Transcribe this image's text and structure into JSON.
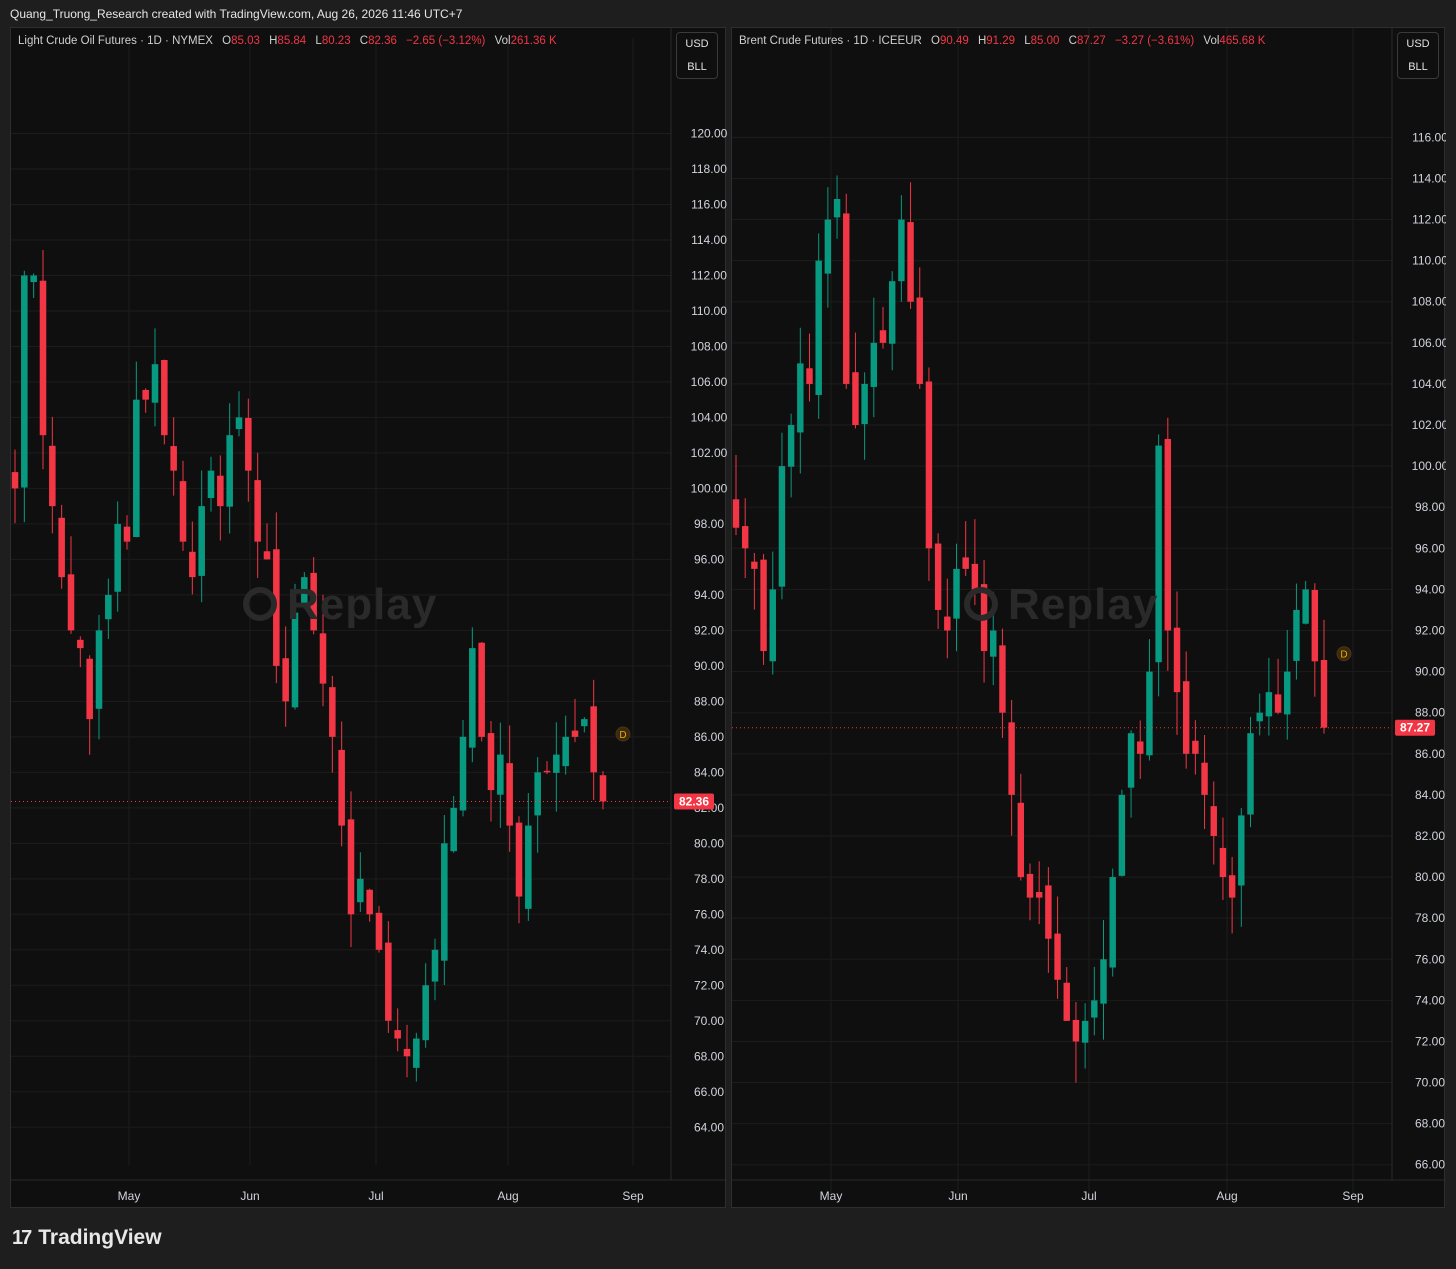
{
  "header": {
    "attribution": "Quang_Truong_Research created with TradingView.com, Aug 26, 2026 11:46 UTC+7"
  },
  "footer": {
    "brand": "TradingView",
    "logo_icon": "tradingview-logo-icon"
  },
  "colors": {
    "up": "#089981",
    "down": "#f23645",
    "background": "#0f0f0f",
    "grid": "#1c1c1c",
    "axis_text": "#d1d4dc"
  },
  "panels": [
    {
      "symbol": "Light Crude Oil Futures",
      "interval": "1D",
      "exchange": "NYMEX",
      "open_label": "O",
      "open": "85.03",
      "high_label": "H",
      "high": "85.84",
      "low_label": "L",
      "low": "80.23",
      "close_label": "C",
      "close": "82.36",
      "change": "−2.65 (−3.12%)",
      "vol_label": "Vol",
      "volume": "261.36 K",
      "currency": "USD",
      "unit": "BLL",
      "watermark": "Replay",
      "marker": "D",
      "last_price_label": "82.36"
    },
    {
      "symbol": "Brent Crude Futures",
      "interval": "1D",
      "exchange": "ICEEUR",
      "open_label": "O",
      "open": "90.49",
      "high_label": "H",
      "high": "91.29",
      "low_label": "L",
      "low": "85.00",
      "close_label": "C",
      "close": "87.27",
      "change": "−3.27 (−3.61%)",
      "vol_label": "Vol",
      "volume": "465.68 K",
      "currency": "USD",
      "unit": "BLL",
      "watermark": "Replay",
      "marker": "D",
      "last_price_label": "87.27"
    }
  ],
  "chart_data": [
    {
      "type": "candlestick",
      "title": "Light Crude Oil Futures · 1D · NYMEX",
      "x": [
        "May",
        "Jun",
        "Jul",
        "Aug",
        "Sep"
      ],
      "y_ticks": [
        "64.00",
        "66.00",
        "68.00",
        "70.00",
        "72.00",
        "74.00",
        "76.00",
        "78.00",
        "80.00",
        "82.00",
        "84.00",
        "86.00",
        "88.00",
        "90.00",
        "92.00",
        "94.00",
        "96.00",
        "98.00",
        "100.00",
        "102.00",
        "104.00",
        "106.00",
        "108.00",
        "110.00",
        "112.00",
        "114.00",
        "116.00",
        "118.00",
        "120.00"
      ],
      "ylim": [
        63,
        122
      ],
      "last_price": 82.36,
      "series": [
        {
          "name": "Light Crude Oil Futures",
          "closes": [
            100,
            112,
            112,
            103,
            99,
            95,
            92,
            91,
            87,
            92,
            94,
            98,
            97,
            105,
            105,
            107,
            103,
            101,
            97,
            95,
            99,
            101,
            99,
            103,
            104,
            101,
            97,
            96,
            90,
            88,
            93,
            95,
            92,
            89,
            86,
            81,
            76,
            78,
            76,
            74,
            70,
            69,
            68,
            69,
            72,
            74,
            80,
            82,
            86,
            91,
            86,
            83,
            85,
            81,
            77,
            81,
            84,
            84,
            85,
            86,
            86,
            87,
            84,
            82.36
          ]
        }
      ]
    },
    {
      "type": "candlestick",
      "title": "Brent Crude Futures · 1D · ICEEUR",
      "x": [
        "May",
        "Jun",
        "Jul",
        "Aug",
        "Sep"
      ],
      "y_ticks": [
        "66.00",
        "68.00",
        "70.00",
        "72.00",
        "74.00",
        "76.00",
        "78.00",
        "80.00",
        "82.00",
        "84.00",
        "86.00",
        "88.00",
        "90.00",
        "92.00",
        "94.00",
        "96.00",
        "98.00",
        "100.00",
        "102.00",
        "104.00",
        "106.00",
        "108.00",
        "110.00",
        "112.00",
        "114.00",
        "116.00"
      ],
      "ylim": [
        65.5,
        118.5
      ],
      "last_price": 87.27,
      "series": [
        {
          "name": "Brent Crude Futures",
          "closes": [
            97,
            96,
            95,
            91,
            94,
            100,
            102,
            105,
            104,
            110,
            112,
            113,
            104,
            102,
            104,
            106,
            106,
            109,
            112,
            108,
            104,
            96,
            93,
            92,
            95,
            95,
            94,
            91,
            92,
            88,
            84,
            80,
            79,
            79,
            77,
            75,
            73,
            72,
            73,
            74,
            76,
            80,
            84,
            87,
            86,
            90,
            101,
            92,
            89,
            86,
            86,
            84,
            82,
            80,
            79,
            83,
            87,
            88,
            89,
            88,
            90,
            93,
            94,
            90.5,
            87.27
          ]
        }
      ]
    }
  ]
}
